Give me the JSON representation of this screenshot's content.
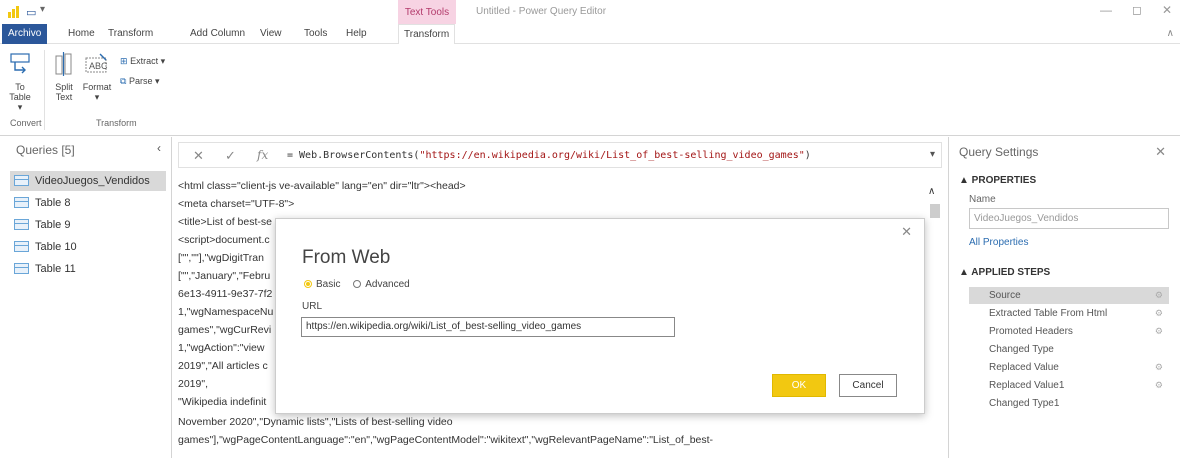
{
  "titlebar": {
    "context_tab_title": "Text Tools",
    "window_title": "Untitled - Power Query Editor",
    "minimize": "—",
    "restore": "◻",
    "close": "✕"
  },
  "tabs": {
    "file": "Archivo",
    "home": "Home",
    "transform": "Transform",
    "add_column": "Add Column",
    "view": "View",
    "tools": "Tools",
    "help": "Help",
    "ctx_transform": "Transform"
  },
  "ribbon": {
    "to_table_1": "To",
    "to_table_2": "Table ▾",
    "split_text_1": "Split",
    "split_text_2": "Text",
    "format_1": "Format",
    "format_2": "▾",
    "extract": "Extract ▾",
    "parse": "Parse ▾",
    "group_convert": "Convert",
    "group_transform": "Transform"
  },
  "queries": {
    "header": "Queries [5]",
    "items": [
      {
        "label": "VideoJuegos_Vendidos"
      },
      {
        "label": "Table 8"
      },
      {
        "label": "Table 9"
      },
      {
        "label": "Table 10"
      },
      {
        "label": "Table 11"
      }
    ]
  },
  "formula_bar": {
    "cancel": "✕",
    "commit": "✓",
    "fx": "fx",
    "prefix": "= Web.BrowserContents(",
    "string": "\"https://en.wikipedia.org/wiki/List_of_best-selling_video_games\"",
    "suffix": ")"
  },
  "content_lines": [
    "<html class=\"client-js ve-available\" lang=\"en\" dir=\"ltr\"><head>",
    "<meta charset=\"UTF-8\">",
    "<title>List of best-se",
    "<script>document.c",
    "[\"\",\"\"],\"wgDigitTran",
    "[\"\",\"January\",\"Febru",
    "6e13-4911-9e37-7f2",
    "1,\"wgNamespaceNu",
    "games\",\"wgCurRevi",
    "1,\"wgAction\":\"view",
    "2019\",\"All articles c",
    "2019\",",
    "\"Wikipedia indefinit",
    "November 2020\",\"Dynamic lists\",\"Lists of best-selling video",
    "games\"],\"wgPageContentLanguage\":\"en\",\"wgPageContentModel\":\"wikitext\",\"wgRelevantPageName\":\"List_of_best-"
  ],
  "query_settings": {
    "title": "Query Settings",
    "properties_header": "▲ PROPERTIES",
    "name_label": "Name",
    "name_value": "VideoJuegos_Vendidos",
    "all_properties": "All Properties",
    "applied_steps_header": "▲ APPLIED STEPS",
    "steps": [
      {
        "label": "Source",
        "gear": "⚙"
      },
      {
        "label": "Extracted Table From Html",
        "gear": "⚙"
      },
      {
        "label": "Promoted Headers",
        "gear": "⚙"
      },
      {
        "label": "Changed Type",
        "gear": ""
      },
      {
        "label": "Replaced Value",
        "gear": "⚙"
      },
      {
        "label": "Replaced Value1",
        "gear": "⚙"
      },
      {
        "label": "Changed Type1",
        "gear": ""
      }
    ]
  },
  "dialog": {
    "title": "From Web",
    "close": "✕",
    "basic": "Basic",
    "advanced": "Advanced",
    "url_label": "URL",
    "url_value": "https://en.wikipedia.org/wiki/List_of_best-selling_video_games",
    "ok": "OK",
    "cancel": "Cancel"
  },
  "colors": {
    "accent": "#2b579a",
    "powerbi_yellow": "#f2c811",
    "context_tab": "#f7d3e3"
  }
}
